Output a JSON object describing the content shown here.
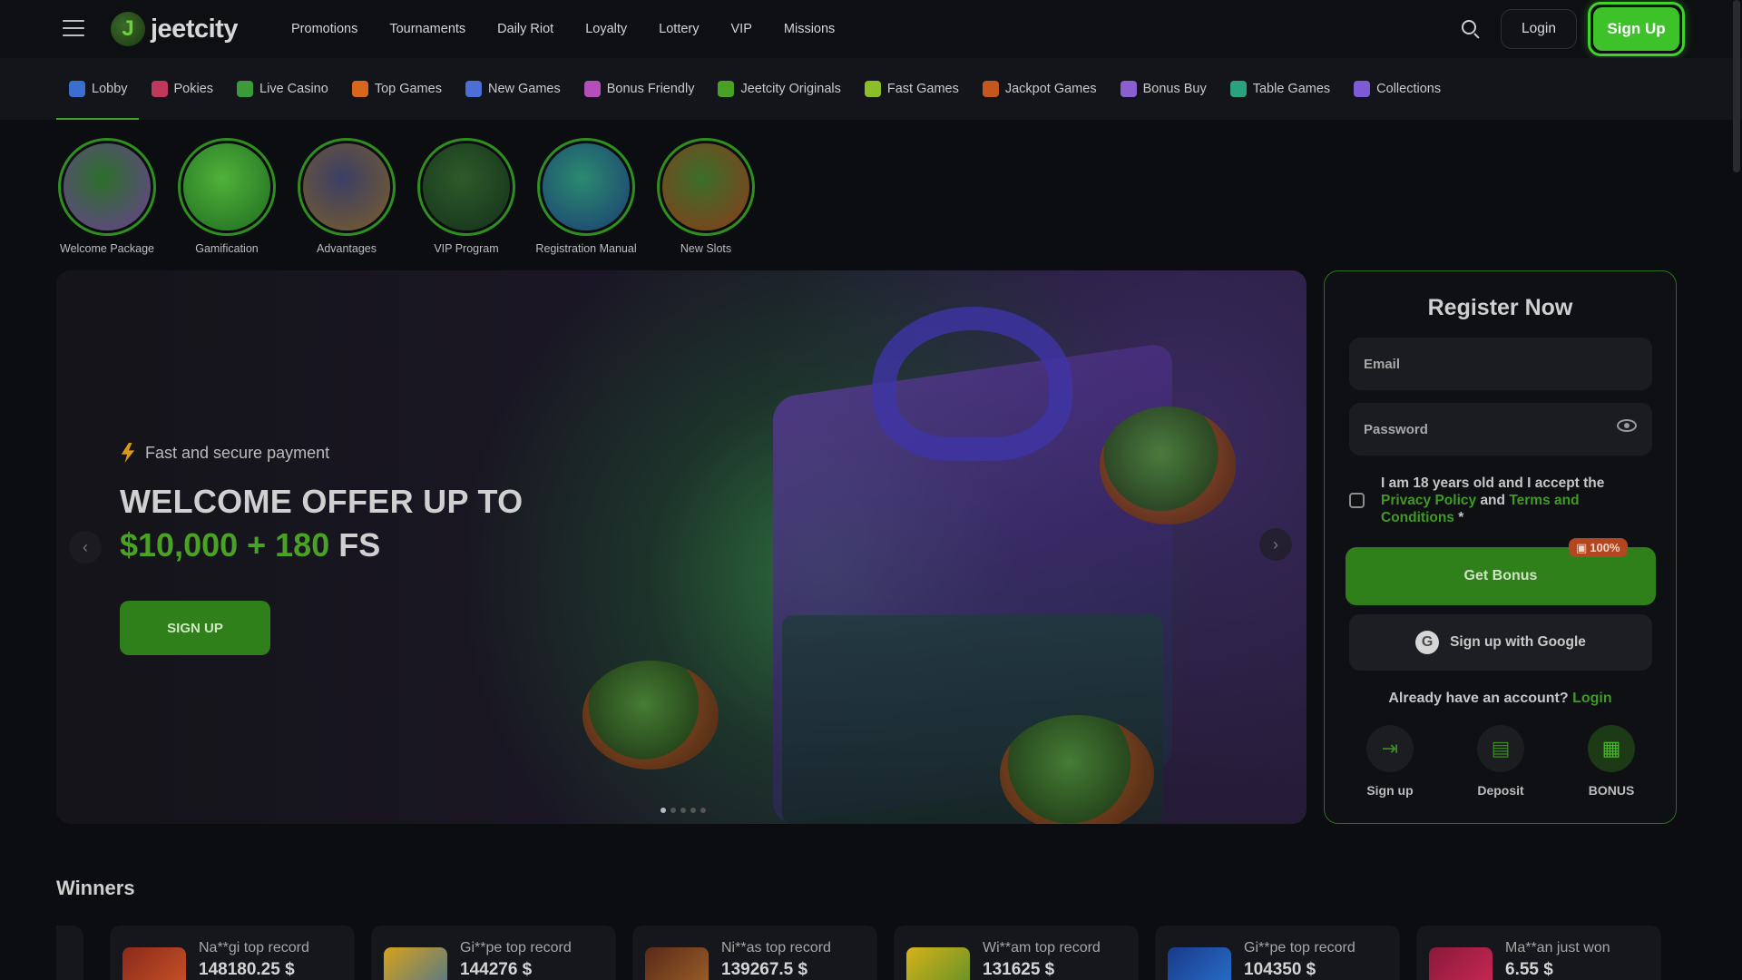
{
  "header": {
    "logo_text": "jeetcity",
    "nav": [
      "Promotions",
      "Tournaments",
      "Daily Riot",
      "Loyalty",
      "Lottery",
      "VIP",
      "Missions"
    ],
    "login_label": "Login",
    "signup_label": "Sign Up"
  },
  "categories": [
    {
      "label": "Lobby",
      "icon": "home-icon",
      "color": "#3a6fd0"
    },
    {
      "label": "Pokies",
      "icon": "cherries-icon",
      "color": "#c0395c"
    },
    {
      "label": "Live Casino",
      "icon": "play-icon",
      "color": "#3b9b3a"
    },
    {
      "label": "Top Games",
      "icon": "flame-icon",
      "color": "#d8661c"
    },
    {
      "label": "New Games",
      "icon": "calendar-icon",
      "color": "#4c6fd6"
    },
    {
      "label": "Bonus Friendly",
      "icon": "gift-icon",
      "color": "#b24fb8"
    },
    {
      "label": "Jeetcity Originals",
      "icon": "jeetcity-logo-icon",
      "color": "#4aa224"
    },
    {
      "label": "Fast Games",
      "icon": "rocket-icon",
      "color": "#8bbf2a"
    },
    {
      "label": "Jackpot Games",
      "icon": "jackpot-icon",
      "color": "#c4561e"
    },
    {
      "label": "Bonus Buy",
      "icon": "cart-icon",
      "color": "#8a5fd0"
    },
    {
      "label": "Table Games",
      "icon": "chip-icon",
      "color": "#2aa27e"
    },
    {
      "label": "Collections",
      "icon": "folder-icon",
      "color": "#7c5cd6"
    }
  ],
  "stories": [
    {
      "label": "Welcome Package",
      "colors": [
        "#2c6f2a",
        "#6b3f93"
      ]
    },
    {
      "label": "Gamification",
      "colors": [
        "#4fb23a",
        "#1f6b20"
      ]
    },
    {
      "label": "Advantages",
      "colors": [
        "#3b3f66",
        "#7a5d2a"
      ]
    },
    {
      "label": "VIP Program",
      "colors": [
        "#2e5b2a",
        "#14301a"
      ]
    },
    {
      "label": "Registration Manual",
      "colors": [
        "#2b8a6f",
        "#1b3d73"
      ]
    },
    {
      "label": "New Slots",
      "colors": [
        "#3b6e2a",
        "#8a3b1a"
      ]
    }
  ],
  "hero": {
    "subtitle": "Fast and secure payment",
    "title": "WELCOME OFFER UP TO",
    "amount": "$10,000 + 180",
    "amount_suffix": "FS",
    "button": "SIGN UP",
    "prev": "‹",
    "next": "›",
    "slides": 5,
    "active_slide": 1
  },
  "register": {
    "title": "Register Now",
    "email_placeholder": "Email",
    "password_placeholder": "Password",
    "terms_prefix": "I am 18 years old and I accept the",
    "privacy_link": "Privacy Policy",
    "terms_and": "and",
    "terms_link": "Terms and Conditions",
    "terms_suffix": "*",
    "get_bonus": "Get Bonus",
    "badge": "100%",
    "google": "Sign up with Google",
    "have_account": "Already have an account?",
    "login_link": "Login",
    "steps": [
      {
        "label": "Sign up",
        "icon": "sign-in-icon"
      },
      {
        "label": "Deposit",
        "icon": "wallet-icon"
      },
      {
        "label": "BONUS",
        "icon": "gift-icon"
      }
    ]
  },
  "winners": {
    "title": "Winners",
    "items": [
      {
        "who": "Na**gi top record",
        "amount": "148180.25 $",
        "thumb": [
          "#8a2a1a",
          "#d45a2a"
        ]
      },
      {
        "who": "Gi**pe top record",
        "amount": "144276 $",
        "thumb": [
          "#d6a21a",
          "#3a6fa0"
        ]
      },
      {
        "who": "Ni**as top record",
        "amount": "139267.5 $",
        "thumb": [
          "#5a2a1a",
          "#a86a2a"
        ]
      },
      {
        "who": "Wi**am top record",
        "amount": "131625 $",
        "thumb": [
          "#d6b21a",
          "#4a8a2a"
        ]
      },
      {
        "who": "Gi**pe top record",
        "amount": "104350 $",
        "thumb": [
          "#1a3a8a",
          "#2a7ad6"
        ]
      },
      {
        "who": "Ma**an just won",
        "amount": "6.55 $",
        "thumb": [
          "#8a1a3a",
          "#d62a5a"
        ]
      }
    ]
  },
  "accent": "#3fa427"
}
